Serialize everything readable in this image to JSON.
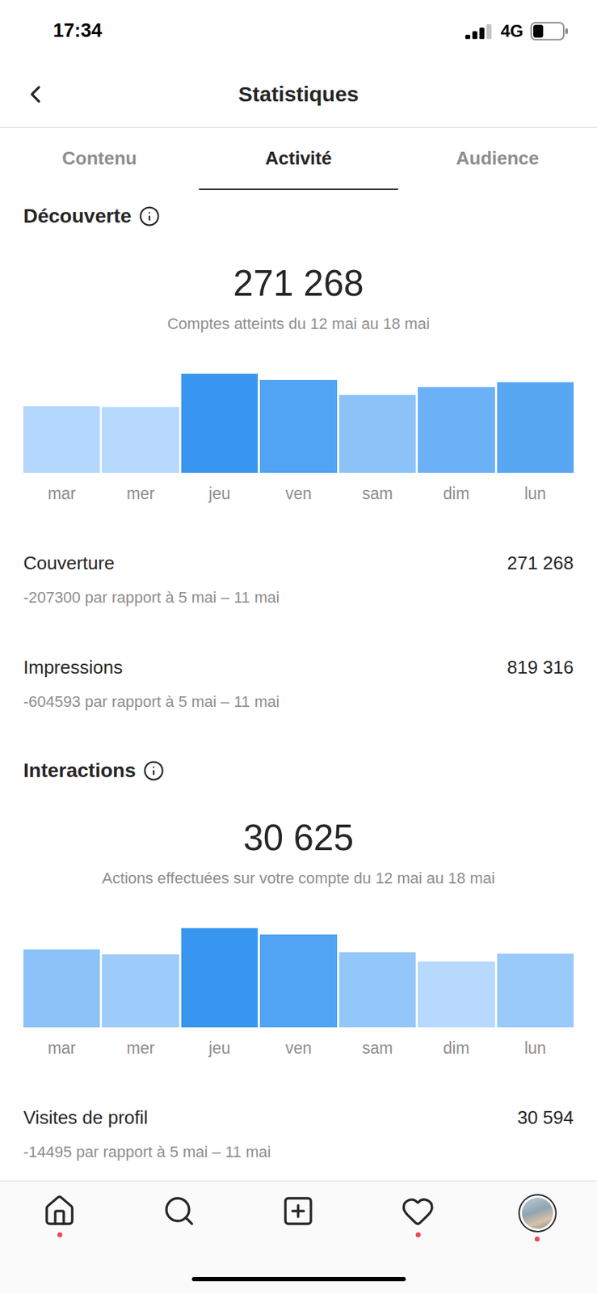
{
  "status_bar": {
    "time": "17:34",
    "network": "4G",
    "signal": 0.75,
    "battery": 0.35
  },
  "header": {
    "title": "Statistiques"
  },
  "tabs": [
    {
      "label": "Contenu",
      "selected": false
    },
    {
      "label": "Activité",
      "selected": true
    },
    {
      "label": "Audience",
      "selected": false
    }
  ],
  "sections": [
    {
      "title": "Découverte",
      "total": "271 268",
      "caption": "Comptes atteints du 12 mai au 18 mai",
      "chart": {
        "days": [
          "mar",
          "mer",
          "jeu",
          "ven",
          "sam",
          "dim",
          "lun"
        ],
        "values": [
          81,
          80,
          120,
          112,
          94,
          104,
          110
        ]
      },
      "metrics": [
        {
          "label": "Couverture",
          "value": "271 268",
          "change": "-207300 par rapport à 5 mai – 11 mai"
        },
        {
          "label": "Impressions",
          "value": "819 316",
          "change": "-604593 par rapport à 5 mai – 11 mai"
        }
      ]
    },
    {
      "title": "Interactions",
      "total": "30 625",
      "caption": "Actions effectuées sur votre compte du 12 mai au 18 mai",
      "chart": {
        "days": [
          "mar",
          "mer",
          "jeu",
          "ven",
          "sam",
          "dim",
          "lun"
        ],
        "values": [
          94,
          88,
          120,
          112,
          91,
          80,
          89
        ]
      },
      "metrics": [
        {
          "label": "Visites de profil",
          "value": "30 594",
          "change": "-14495 par rapport à 5 mai – 11 mai"
        }
      ]
    }
  ],
  "nav": [
    {
      "badge": true
    },
    {
      "badge": false
    },
    {
      "badge": false
    },
    {
      "badge": true
    },
    {
      "badge": true
    }
  ]
}
